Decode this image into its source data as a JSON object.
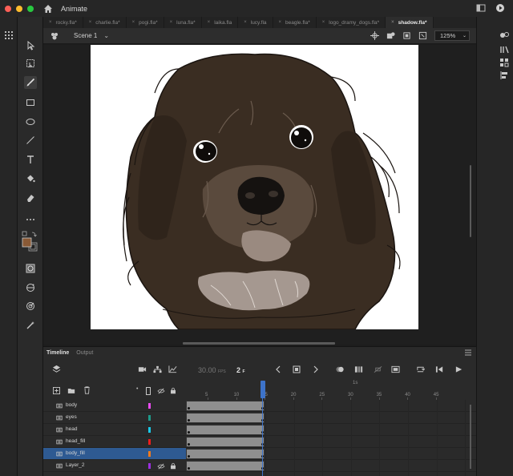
{
  "app": {
    "title": "Animate"
  },
  "tabs": [
    {
      "label": "rocky.fla*"
    },
    {
      "label": "charlie.fla*"
    },
    {
      "label": "pogi.fla*"
    },
    {
      "label": "luna.fla*"
    },
    {
      "label": "laika.fla"
    },
    {
      "label": "lucy.fla"
    },
    {
      "label": "beagle.fla*"
    },
    {
      "label": "logo_dramy_dogs.fla*"
    },
    {
      "label": "shadow.fla*",
      "active": true
    }
  ],
  "scene": {
    "name": "Scene 1",
    "zoom": "125%"
  },
  "tools": {
    "fill_color": "#8a5a36",
    "stroke_color": "#000000"
  },
  "timeline": {
    "tab_timeline": "Timeline",
    "tab_output": "Output",
    "fps": "30.00",
    "fps_unit": "FPS",
    "current_frame": "2",
    "frame_unit": "F",
    "ruler_time_label": "1s",
    "ruler_numbers": [
      "5",
      "10",
      "15",
      "20",
      "25",
      "30",
      "35",
      "40",
      "45"
    ],
    "layers": [
      {
        "name": "body",
        "color": "#e94cf0"
      },
      {
        "name": "eyes",
        "color": "#1d9a8a"
      },
      {
        "name": "head",
        "color": "#19c9e8"
      },
      {
        "name": "head_fill",
        "color": "#f01c1c"
      },
      {
        "name": "body_fill",
        "color": "#f07a1c",
        "selected": true
      },
      {
        "name": "Layer_2",
        "color": "#9b2fe0"
      }
    ]
  }
}
